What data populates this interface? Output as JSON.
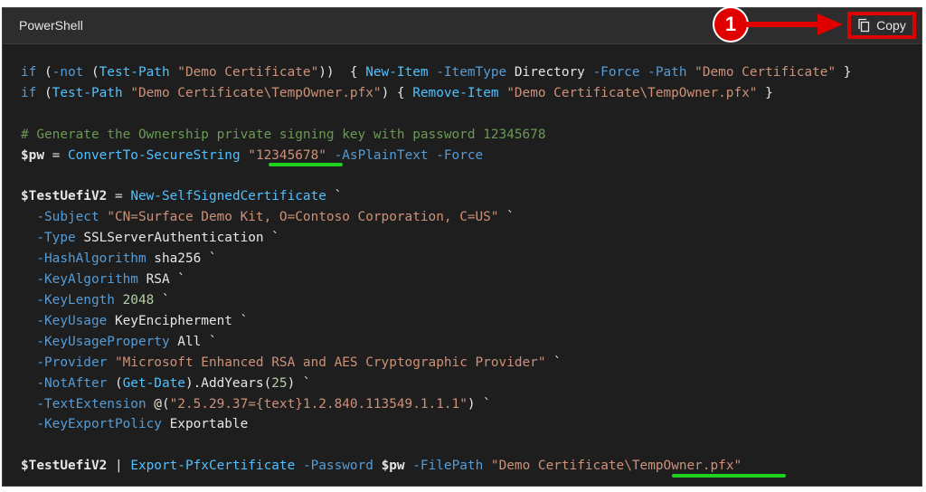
{
  "header": {
    "language": "PowerShell",
    "copy_label": "Copy"
  },
  "annotation": {
    "step_number": "1"
  },
  "colors": {
    "annotation_red": "#e00000",
    "underline_green": "#1fd11f",
    "code_background": "#1e1e1e"
  },
  "icons": {
    "copy": "copy-icon"
  },
  "code": {
    "lines": [
      [
        [
          "kw",
          "if"
        ],
        [
          "plain",
          " ("
        ],
        [
          "kw",
          "-not"
        ],
        [
          "plain",
          " ("
        ],
        [
          "cmd",
          "Test-Path"
        ],
        [
          "plain",
          " "
        ],
        [
          "str",
          "\"Demo Certificate\""
        ],
        [
          "plain",
          "))  { "
        ],
        [
          "cmd",
          "New-Item"
        ],
        [
          "plain",
          " "
        ],
        [
          "kw",
          "-ItemType"
        ],
        [
          "plain",
          " Directory "
        ],
        [
          "kw",
          "-Force"
        ],
        [
          "plain",
          " "
        ],
        [
          "kw",
          "-Path"
        ],
        [
          "plain",
          " "
        ],
        [
          "str",
          "\"Demo Certificate\""
        ],
        [
          "plain",
          " }"
        ]
      ],
      [
        [
          "kw",
          "if"
        ],
        [
          "plain",
          " ("
        ],
        [
          "cmd",
          "Test-Path"
        ],
        [
          "plain",
          " "
        ],
        [
          "str",
          "\"Demo Certificate\\TempOwner.pfx\""
        ],
        [
          "plain",
          ") { "
        ],
        [
          "cmd",
          "Remove-Item"
        ],
        [
          "plain",
          " "
        ],
        [
          "str",
          "\"Demo Certificate\\TempOwner.pfx\""
        ],
        [
          "plain",
          " }"
        ]
      ],
      [],
      [
        [
          "cmt",
          "# Generate the Ownership private signing key with password 12345678"
        ]
      ],
      [
        [
          "var",
          "$pw"
        ],
        [
          "plain",
          " = "
        ],
        [
          "cmd",
          "ConvertTo-SecureString"
        ],
        [
          "plain",
          " "
        ],
        [
          "str",
          "\"12345678\""
        ],
        [
          "plain",
          " "
        ],
        [
          "kw",
          "-AsPlainText"
        ],
        [
          "plain",
          " "
        ],
        [
          "kw",
          "-Force"
        ]
      ],
      [],
      [
        [
          "var",
          "$TestUefiV2"
        ],
        [
          "plain",
          " = "
        ],
        [
          "cmd",
          "New-SelfSignedCertificate"
        ],
        [
          "plain",
          " `"
        ]
      ],
      [
        [
          "plain",
          "  "
        ],
        [
          "kw",
          "-Subject"
        ],
        [
          "plain",
          " "
        ],
        [
          "str",
          "\"CN=Surface Demo Kit, O=Contoso Corporation, C=US\""
        ],
        [
          "plain",
          " `"
        ]
      ],
      [
        [
          "plain",
          "  "
        ],
        [
          "kw",
          "-Type"
        ],
        [
          "plain",
          " SSLServerAuthentication `"
        ]
      ],
      [
        [
          "plain",
          "  "
        ],
        [
          "kw",
          "-HashAlgorithm"
        ],
        [
          "plain",
          " sha256 `"
        ]
      ],
      [
        [
          "plain",
          "  "
        ],
        [
          "kw",
          "-KeyAlgorithm"
        ],
        [
          "plain",
          " RSA `"
        ]
      ],
      [
        [
          "plain",
          "  "
        ],
        [
          "kw",
          "-KeyLength"
        ],
        [
          "plain",
          " "
        ],
        [
          "num",
          "2048"
        ],
        [
          "plain",
          " `"
        ]
      ],
      [
        [
          "plain",
          "  "
        ],
        [
          "kw",
          "-KeyUsage"
        ],
        [
          "plain",
          " KeyEncipherment `"
        ]
      ],
      [
        [
          "plain",
          "  "
        ],
        [
          "kw",
          "-KeyUsageProperty"
        ],
        [
          "plain",
          " All `"
        ]
      ],
      [
        [
          "plain",
          "  "
        ],
        [
          "kw",
          "-Provider"
        ],
        [
          "plain",
          " "
        ],
        [
          "str",
          "\"Microsoft Enhanced RSA and AES Cryptographic Provider\""
        ],
        [
          "plain",
          " `"
        ]
      ],
      [
        [
          "plain",
          "  "
        ],
        [
          "kw",
          "-NotAfter"
        ],
        [
          "plain",
          " ("
        ],
        [
          "cmd",
          "Get-Date"
        ],
        [
          "plain",
          ").AddYears("
        ],
        [
          "num",
          "25"
        ],
        [
          "plain",
          ") `"
        ]
      ],
      [
        [
          "plain",
          "  "
        ],
        [
          "kw",
          "-TextExtension"
        ],
        [
          "plain",
          " @("
        ],
        [
          "str",
          "\"2.5.29.37={text}1.2.840.113549.1.1.1\""
        ],
        [
          "plain",
          ") `"
        ]
      ],
      [
        [
          "plain",
          "  "
        ],
        [
          "kw",
          "-KeyExportPolicy"
        ],
        [
          "plain",
          " Exportable"
        ]
      ],
      [],
      [
        [
          "var",
          "$TestUefiV2"
        ],
        [
          "plain",
          " | "
        ],
        [
          "cmd",
          "Export-PfxCertificate"
        ],
        [
          "plain",
          " "
        ],
        [
          "kw",
          "-Password"
        ],
        [
          "plain",
          " "
        ],
        [
          "var",
          "$pw"
        ],
        [
          "plain",
          " "
        ],
        [
          "kw",
          "-FilePath"
        ],
        [
          "plain",
          " "
        ],
        [
          "str",
          "\"Demo Certificate\\TempOwner.pfx\""
        ]
      ]
    ]
  }
}
